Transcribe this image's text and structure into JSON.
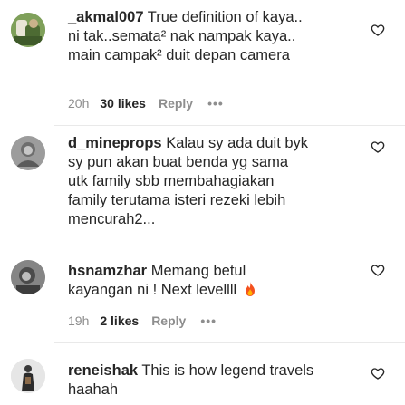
{
  "comments": [
    {
      "username": "_akmal007",
      "text": " True definition of kaya..\nni tak..semata² nak nampak kaya..\nmain campak² duit depan camera",
      "time": "20h",
      "likes": "30 likes",
      "reply": "Reply",
      "more": "•••"
    },
    {
      "username": "d_mineprops",
      "text": " Kalau sy ada duit byk\nsy pun akan buat benda yg sama\nutk family sbb membahagiakan\nfamily terutama isteri rezeki lebih\nmencurah2..."
    },
    {
      "username": "hsnamzhar",
      "text": " Memang betul\nkayangan ni ! Next levellll ",
      "emoji": "fire-emoji",
      "time": "19h",
      "likes": "2 likes",
      "reply": "Reply",
      "more": "•••"
    },
    {
      "username": "reneishak",
      "text": " This is how legend travels\nhaahah"
    }
  ],
  "colors": {
    "text": "#262626",
    "secondary": "#8e8e8e",
    "divider": "#e9e9e9",
    "fire": "#f4511e"
  },
  "icons": {
    "like": "heart-outline-icon"
  }
}
